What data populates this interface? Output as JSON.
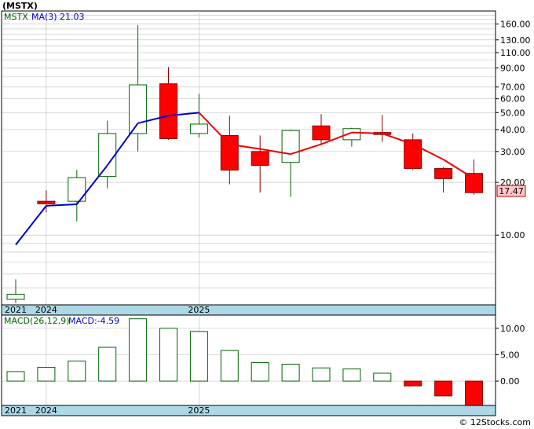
{
  "title": "(MSTX)",
  "legend": {
    "ticker": "MSTX",
    "ma_label": "MA(3)",
    "ma_value": "21.03"
  },
  "macd_legend": {
    "params": "MACD(26,12,9)",
    "value_label": "MACD:-4.59"
  },
  "last_price": "17.47",
  "watermark": "© 12Stocks.com",
  "colors": {
    "up": "#006400",
    "down": "#ff0000",
    "ma_up": "#0000cc",
    "ma_down": "#ee0000",
    "band": "#add8e6",
    "grid": "#c8c8c8",
    "price_box": "#ffc8c8"
  },
  "x_labels": [
    "2021",
    "2024",
    "2025"
  ],
  "chart_data": [
    {
      "type": "candlestick",
      "title": "(MSTX)",
      "scale": "log",
      "ylim": [
        4.0,
        190
      ],
      "y_ticks": [
        160,
        130,
        110,
        90,
        70,
        60,
        50,
        40,
        30,
        20,
        10
      ],
      "y_tick_labels": [
        "160.00",
        "130.00",
        "110.00",
        "90.00",
        "70.00",
        "60.00",
        "50.00",
        "40.00",
        "30.00",
        "20.00",
        "10.00"
      ],
      "grid": true,
      "candles": [
        {
          "period": "2021",
          "open": 4.3,
          "high": 5.6,
          "low": 4.1,
          "close": 4.6
        },
        {
          "period": "2024",
          "open": 15.6,
          "high": 18.0,
          "low": 13.5,
          "close": 15.1
        },
        {
          "period": "",
          "open": 15.6,
          "high": 23.5,
          "low": 12.0,
          "close": 21.3
        },
        {
          "period": "",
          "open": 21.6,
          "high": 45.0,
          "low": 18.5,
          "close": 38.0
        },
        {
          "period": "",
          "open": 38.0,
          "high": 158.0,
          "low": 30.0,
          "close": 72.0
        },
        {
          "period": "",
          "open": 73.0,
          "high": 91.0,
          "low": 35.0,
          "close": 35.5
        },
        {
          "period": "2025",
          "open": 38.0,
          "high": 64.0,
          "low": 36.0,
          "close": 43.0
        },
        {
          "period": "",
          "open": 37.0,
          "high": 48.0,
          "low": 19.5,
          "close": 23.5
        },
        {
          "period": "",
          "open": 30.0,
          "high": 37.0,
          "low": 17.5,
          "close": 25.0
        },
        {
          "period": "",
          "open": 26.0,
          "high": 40.0,
          "low": 16.5,
          "close": 39.5
        },
        {
          "period": "",
          "open": 42.0,
          "high": 49.0,
          "low": 33.0,
          "close": 35.0
        },
        {
          "period": "",
          "open": 35.0,
          "high": 41.0,
          "low": 32.0,
          "close": 40.5
        },
        {
          "period": "",
          "open": 38.5,
          "high": 48.5,
          "low": 34.0,
          "close": 37.5
        },
        {
          "period": "",
          "open": 35.0,
          "high": 38.0,
          "low": 23.5,
          "close": 24.0
        },
        {
          "period": "",
          "open": 24.0,
          "high": 24.5,
          "low": 17.5,
          "close": 21.0
        },
        {
          "period": "",
          "open": 22.5,
          "high": 27.0,
          "low": 17.0,
          "close": 17.47
        }
      ],
      "series": [
        {
          "name": "MA(3)",
          "values": [
            8.8,
            14.7,
            15.0,
            25.0,
            43.5,
            48.0,
            50.0,
            33.0,
            31.0,
            29.0,
            33.0,
            38.5,
            38.0,
            33.0,
            27.0,
            21.03
          ]
        }
      ]
    },
    {
      "type": "bar",
      "title": "MACD(26,12,9)",
      "ylim": [
        -4.6,
        12.5
      ],
      "y_ticks": [
        10.0,
        5.0,
        0.0
      ],
      "y_tick_labels": [
        "10.00",
        "5.00",
        "0.00"
      ],
      "values": [
        1.8,
        2.6,
        3.8,
        6.4,
        11.8,
        10.0,
        9.4,
        5.8,
        3.5,
        3.2,
        2.5,
        2.3,
        1.5,
        -0.9,
        -2.8,
        -4.59
      ]
    }
  ]
}
